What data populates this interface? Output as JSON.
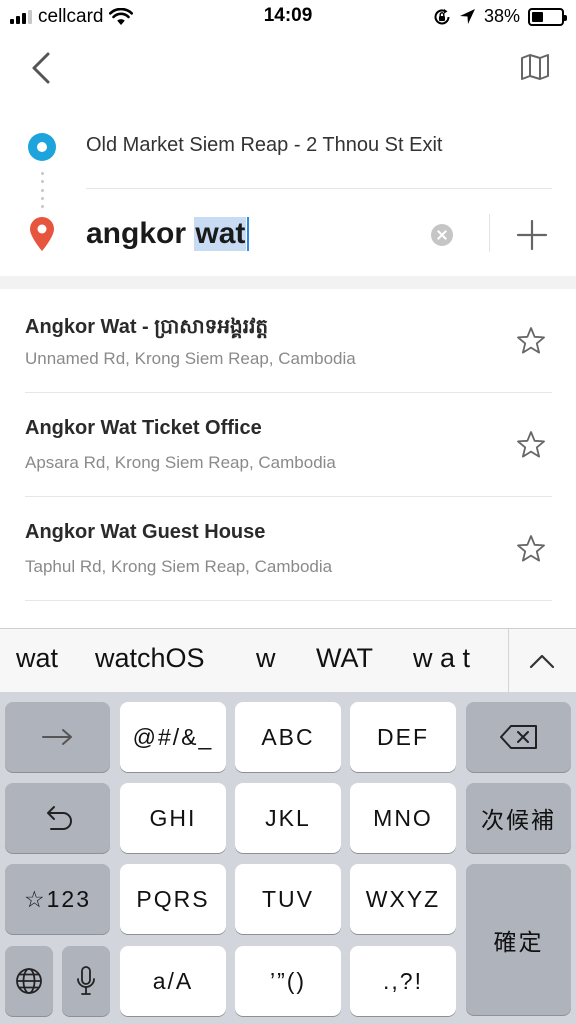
{
  "status_bar": {
    "carrier": "cellcard",
    "time": "14:09",
    "battery_percent": "38%",
    "battery_level": 0.38,
    "signal_bars_filled": 3,
    "signal_bars_total": 4
  },
  "header": {
    "back_icon": "chevron-left-icon",
    "map_icon": "map-icon"
  },
  "route": {
    "origin": "Old Market Siem Reap - 2 Thnou St Exit",
    "destination_typed": "angkor ",
    "destination_selected": "wat",
    "colors": {
      "origin": "#1ea4dc",
      "destination": "#e8553e"
    }
  },
  "results": [
    {
      "title": "Angkor Wat - ប្រាសាទអង្គរវត្ត",
      "subtitle": "Unnamed Rd, Krong Siem Reap, Cambodia"
    },
    {
      "title": "Angkor Wat Ticket Office",
      "subtitle": "Apsara Rd, Krong Siem Reap, Cambodia"
    },
    {
      "title": "Angkor Wat Guest House",
      "subtitle": "Taphul Rd, Krong Siem Reap, Cambodia"
    }
  ],
  "keyboard": {
    "candidates": [
      "wat",
      "watchOS",
      "w",
      "WAT",
      "w a t"
    ],
    "keys": {
      "punct": "@#/&_",
      "abc": "ABC",
      "def": "DEF",
      "ghi": "GHI",
      "jkl": "JKL",
      "mno": "MNO",
      "next_candidate": "次候補",
      "mode_123": "☆123",
      "pqrs": "PQRS",
      "tuv": "TUV",
      "wxyz": "WXYZ",
      "confirm": "確定",
      "case": "a/A",
      "quotes": "’”()",
      "punct2": ".,?!"
    }
  }
}
